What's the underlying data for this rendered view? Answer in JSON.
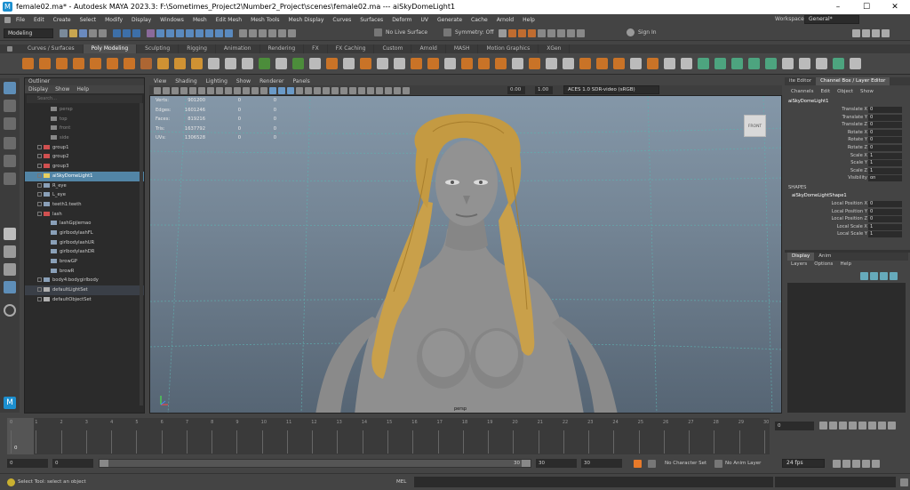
{
  "titlebar": {
    "app_icon": "M",
    "title": "female02.ma* - Autodesk MAYA 2023.3: F:\\Sometimes_Project2\\Number2_Project\\scenes\\female02.ma   ---   aiSkyDomeLight1",
    "minimize": "–",
    "maximize": "☐",
    "close": "✕"
  },
  "menubar": {
    "items": [
      "File",
      "Edit",
      "Create",
      "Select",
      "Modify",
      "Display",
      "Windows",
      "Mesh",
      "Edit Mesh",
      "Mesh Tools",
      "Mesh Display",
      "Curves",
      "Surfaces",
      "Deform",
      "UV",
      "Generate",
      "Cache",
      "Arnold",
      "Help"
    ],
    "workspace_label": "Workspace :",
    "workspace_value": "General*"
  },
  "statusline": {
    "mode": "Modeling",
    "live_surface": "No Live Surface",
    "symmetry": "Symmetry: Off",
    "sign_in": "Sign In"
  },
  "shelf": {
    "tabs": [
      "Curves / Surfaces",
      "Poly Modeling",
      "Sculpting",
      "Rigging",
      "Animation",
      "Rendering",
      "FX",
      "FX Caching",
      "Custom",
      "Arnold",
      "MASH",
      "Motion Graphics",
      "XGen"
    ],
    "active": "Poly Modeling"
  },
  "outliner": {
    "title": "Outliner",
    "menu": [
      "Display",
      "Show",
      "Help"
    ],
    "search_placeholder": "Search...",
    "rows": [
      {
        "label": "persp",
        "indent": 2,
        "icon": "camera-icon",
        "style": "dim"
      },
      {
        "label": "top",
        "indent": 2,
        "icon": "camera-icon",
        "style": "dim"
      },
      {
        "label": "front",
        "indent": 2,
        "icon": "camera-icon",
        "style": "dim"
      },
      {
        "label": "side",
        "indent": 2,
        "icon": "camera-icon",
        "style": "dim"
      },
      {
        "label": "group1",
        "indent": 1,
        "icon": "group-icon",
        "style": ""
      },
      {
        "label": "group2",
        "indent": 1,
        "icon": "group-icon",
        "style": ""
      },
      {
        "label": "group3",
        "indent": 1,
        "icon": "group-icon",
        "style": ""
      },
      {
        "label": "aiSkyDomeLight1",
        "indent": 1,
        "icon": "light-icon",
        "style": "sel"
      },
      {
        "label": "R_eye",
        "indent": 1,
        "icon": "mesh-icon",
        "style": ""
      },
      {
        "label": "L_eye",
        "indent": 1,
        "icon": "mesh-icon",
        "style": ""
      },
      {
        "label": "teeth1:teeth",
        "indent": 1,
        "icon": "mesh-icon",
        "style": ""
      },
      {
        "label": "lash",
        "indent": 1,
        "icon": "group-icon",
        "style": ""
      },
      {
        "label": "lashGpjiemao",
        "indent": 2,
        "icon": "mesh-icon",
        "style": ""
      },
      {
        "label": "girlbodylashFL",
        "indent": 2,
        "icon": "mesh-icon",
        "style": ""
      },
      {
        "label": "girlbodylashUR",
        "indent": 2,
        "icon": "mesh-icon",
        "style": ""
      },
      {
        "label": "girlbodylashDR",
        "indent": 2,
        "icon": "mesh-icon",
        "style": ""
      },
      {
        "label": "browGP",
        "indent": 2,
        "icon": "mesh-icon",
        "style": ""
      },
      {
        "label": "browR",
        "indent": 2,
        "icon": "mesh-icon",
        "style": ""
      },
      {
        "label": "body4:bodygirlbody",
        "indent": 1,
        "icon": "mesh-icon",
        "style": ""
      },
      {
        "label": "defaultLightSet",
        "indent": 1,
        "icon": "set-icon",
        "style": "hl"
      },
      {
        "label": "defaultObjectSet",
        "indent": 1,
        "icon": "set-icon",
        "style": ""
      }
    ]
  },
  "viewport": {
    "menu": [
      "View",
      "Shading",
      "Lighting",
      "Show",
      "Renderer",
      "Panels"
    ],
    "exposure": "0.00",
    "gamma": "1.00",
    "colorspace": "ACES 1.0 SDR-video (sRGB)",
    "hud": [
      {
        "k": "Verts:",
        "v": "901200",
        "a": "0",
        "b": "0"
      },
      {
        "k": "Edges:",
        "v": "1601246",
        "a": "0",
        "b": "0"
      },
      {
        "k": "Faces:",
        "v": "819216",
        "a": "0",
        "b": "0"
      },
      {
        "k": "Tris:",
        "v": "1637792",
        "a": "0",
        "b": "0"
      },
      {
        "k": "UVs:",
        "v": "1306528",
        "a": "0",
        "b": "0"
      }
    ],
    "viewcube": "FRONT",
    "camera": "persp"
  },
  "channelbox": {
    "editor_tab": "ite Editor",
    "main_tab": "Channel Box / Layer Editor",
    "menu": [
      "Channels",
      "Edit",
      "Object",
      "Show"
    ],
    "node": "aiSkyDomeLight1",
    "attrs": [
      {
        "l": "Translate X",
        "v": "0"
      },
      {
        "l": "Translate Y",
        "v": "0"
      },
      {
        "l": "Translate Z",
        "v": "0"
      },
      {
        "l": "Rotate X",
        "v": "0"
      },
      {
        "l": "Rotate Y",
        "v": "0"
      },
      {
        "l": "Rotate Z",
        "v": "0"
      },
      {
        "l": "Scale X",
        "v": "1"
      },
      {
        "l": "Scale Y",
        "v": "1"
      },
      {
        "l": "Scale Z",
        "v": "1"
      },
      {
        "l": "Visibility",
        "v": "on"
      }
    ],
    "shapes_label": "SHAPES",
    "shape_node": "aiSkyDomeLightShape1",
    "shape_attrs": [
      {
        "l": "Local Position X",
        "v": "0"
      },
      {
        "l": "Local Position Y",
        "v": "0"
      },
      {
        "l": "Local Position Z",
        "v": "0"
      },
      {
        "l": "Local Scale X",
        "v": "1"
      },
      {
        "l": "Local Scale Y",
        "v": "1"
      }
    ],
    "layer_tabs": [
      "Display",
      "Anim"
    ],
    "layer_menu": [
      "Layers",
      "Options",
      "Help"
    ]
  },
  "timeslider": {
    "ticks": [
      "0",
      "1",
      "2",
      "3",
      "4",
      "5",
      "6",
      "7",
      "8",
      "9",
      "10",
      "11",
      "12",
      "13",
      "14",
      "15",
      "16",
      "17",
      "18",
      "19",
      "20",
      "21",
      "22",
      "23",
      "24",
      "25",
      "26",
      "27",
      "28",
      "29",
      "30"
    ],
    "current_frame": "0",
    "frame_field": "0"
  },
  "range": {
    "start": "0",
    "start2": "0",
    "slider_end": "30",
    "end": "30",
    "end2": "30",
    "character_set": "No Character Set",
    "anim_layer": "No Anim Layer",
    "fps": "24 fps"
  },
  "cmdline": {
    "help": "Select Tool: select an object",
    "lang": "MEL"
  },
  "colors": {
    "selection": "#5285a6",
    "hair": "#c9a04a",
    "skin": "#8f8f8f",
    "accent": "#1c8fcf"
  }
}
